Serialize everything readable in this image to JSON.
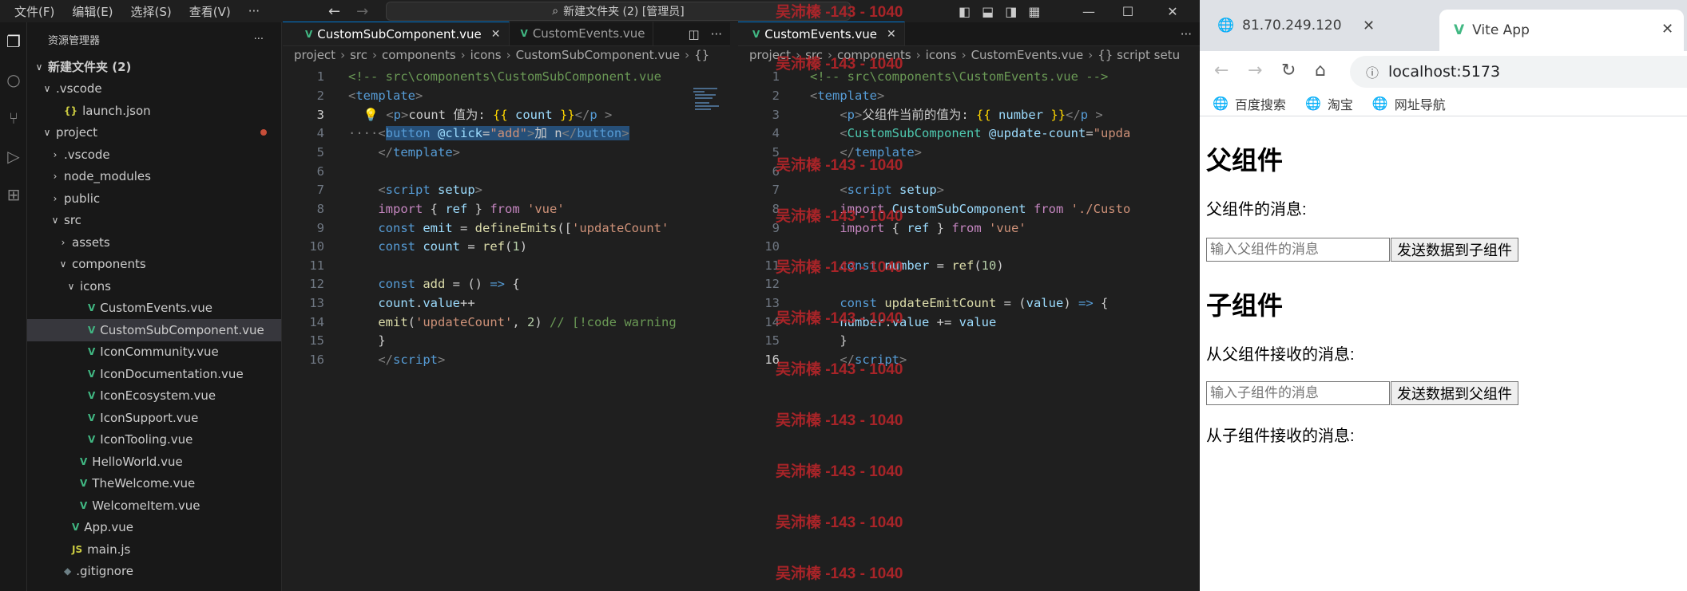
{
  "vscode": {
    "menu": [
      "文件(F)",
      "编辑(E)",
      "选择(S)",
      "查看(V)",
      "···"
    ],
    "command_center": "新建文件夹 (2) [管理员]",
    "explorer_title": "资源管理器",
    "explorer_more": "···",
    "tree": [
      {
        "label": "新建文件夹 (2)",
        "indent": 0,
        "chev": "∨",
        "icon": "",
        "bold": true
      },
      {
        "label": ".vscode",
        "indent": 1,
        "chev": "∨",
        "icon": ""
      },
      {
        "label": "launch.json",
        "indent": 2,
        "chev": "",
        "icon": "{}"
      },
      {
        "label": "project",
        "indent": 1,
        "chev": "∨",
        "icon": "",
        "modified": true
      },
      {
        "label": ".vscode",
        "indent": 2,
        "chev": "›",
        "icon": ""
      },
      {
        "label": "node_modules",
        "indent": 2,
        "chev": "›",
        "icon": ""
      },
      {
        "label": "public",
        "indent": 2,
        "chev": "›",
        "icon": ""
      },
      {
        "label": "src",
        "indent": 2,
        "chev": "∨",
        "icon": ""
      },
      {
        "label": "assets",
        "indent": 3,
        "chev": "›",
        "icon": ""
      },
      {
        "label": "components",
        "indent": 3,
        "chev": "∨",
        "icon": ""
      },
      {
        "label": "icons",
        "indent": 4,
        "chev": "∨",
        "icon": ""
      },
      {
        "label": "CustomEvents.vue",
        "indent": 5,
        "chev": "",
        "icon": "V"
      },
      {
        "label": "CustomSubComponent.vue",
        "indent": 5,
        "chev": "",
        "icon": "V",
        "selected": true
      },
      {
        "label": "IconCommunity.vue",
        "indent": 5,
        "chev": "",
        "icon": "V"
      },
      {
        "label": "IconDocumentation.vue",
        "indent": 5,
        "chev": "",
        "icon": "V"
      },
      {
        "label": "IconEcosystem.vue",
        "indent": 5,
        "chev": "",
        "icon": "V"
      },
      {
        "label": "IconSupport.vue",
        "indent": 5,
        "chev": "",
        "icon": "V"
      },
      {
        "label": "IconTooling.vue",
        "indent": 5,
        "chev": "",
        "icon": "V"
      },
      {
        "label": "HelloWorld.vue",
        "indent": 4,
        "chev": "",
        "icon": "V"
      },
      {
        "label": "TheWelcome.vue",
        "indent": 4,
        "chev": "",
        "icon": "V"
      },
      {
        "label": "WelcomeItem.vue",
        "indent": 4,
        "chev": "",
        "icon": "V"
      },
      {
        "label": "App.vue",
        "indent": 3,
        "chev": "",
        "icon": "V"
      },
      {
        "label": "main.js",
        "indent": 3,
        "chev": "",
        "icon": "JS"
      },
      {
        "label": ".gitignore",
        "indent": 2,
        "chev": "",
        "icon": "◆"
      }
    ],
    "left_group": {
      "tabs": [
        {
          "label": "CustomSubComponent.vue",
          "active": true
        },
        {
          "label": "CustomEvents.vue",
          "active": false
        }
      ],
      "breadcrumbs": [
        "project",
        "src",
        "components",
        "icons",
        "CustomSubComponent.vue",
        "{}"
      ],
      "lines": [
        {
          "n": "1",
          "tokens": [
            {
              "c": "c",
              "t": "<!-- src\\components\\CustomSubComponent.vue"
            }
          ]
        },
        {
          "n": "2",
          "tokens": [
            {
              "c": "tg",
              "t": "<"
            },
            {
              "c": "t",
              "t": "template"
            },
            {
              "c": "tg",
              "t": ">"
            }
          ]
        },
        {
          "n": "3",
          "cur": true,
          "tokens": [
            {
              "c": "txt",
              "t": "  💡 "
            },
            {
              "c": "tg",
              "t": "<"
            },
            {
              "c": "t",
              "t": "p"
            },
            {
              "c": "tg",
              "t": ">"
            },
            {
              "c": "txt",
              "t": "count 值为: "
            },
            {
              "c": "b",
              "t": "{{"
            },
            {
              "c": "v2",
              "t": " count "
            },
            {
              "c": "b",
              "t": "}}"
            },
            {
              "c": "tg",
              "t": "</"
            },
            {
              "c": "t",
              "t": "p"
            },
            {
              "c": "tg",
              "t": " >"
            }
          ]
        },
        {
          "n": "4",
          "hl": true,
          "tokens": [
            {
              "c": "tg",
              "t": "····<"
            },
            {
              "c": "t",
              "t": "button"
            },
            {
              "c": "v2",
              "t": " @click"
            },
            {
              "c": "txt",
              "t": "="
            },
            {
              "c": "s",
              "t": "\"add\""
            },
            {
              "c": "tg",
              "t": ">"
            },
            {
              "c": "txt",
              "t": "加 n"
            },
            {
              "c": "tg",
              "t": "</"
            },
            {
              "c": "t",
              "t": "button"
            },
            {
              "c": "tg",
              "t": ">"
            }
          ]
        },
        {
          "n": "5",
          "tokens": [
            {
              "c": "tg",
              "t": "    </"
            },
            {
              "c": "t",
              "t": "template"
            },
            {
              "c": "tg",
              "t": ">"
            }
          ]
        },
        {
          "n": "6",
          "tokens": []
        },
        {
          "n": "7",
          "tokens": [
            {
              "c": "tg",
              "t": "    <"
            },
            {
              "c": "t",
              "t": "script"
            },
            {
              "c": "v2",
              "t": " setup"
            },
            {
              "c": "tg",
              "t": ">"
            }
          ]
        },
        {
          "n": "8",
          "tokens": [
            {
              "c": "kw",
              "t": "    import"
            },
            {
              "c": "txt",
              "t": " { "
            },
            {
              "c": "v2",
              "t": "ref"
            },
            {
              "c": "txt",
              "t": " } "
            },
            {
              "c": "kw",
              "t": "from"
            },
            {
              "c": "s",
              "t": " 'vue'"
            }
          ]
        },
        {
          "n": "9",
          "tokens": [
            {
              "c": "k2",
              "t": "    const"
            },
            {
              "c": "v2",
              "t": " emit"
            },
            {
              "c": "txt",
              "t": " = "
            },
            {
              "c": "f",
              "t": "defineEmits"
            },
            {
              "c": "txt",
              "t": "(["
            },
            {
              "c": "s",
              "t": "'updateCount'"
            }
          ]
        },
        {
          "n": "10",
          "tokens": [
            {
              "c": "k2",
              "t": "    const"
            },
            {
              "c": "v2",
              "t": " count"
            },
            {
              "c": "txt",
              "t": " = "
            },
            {
              "c": "f",
              "t": "ref"
            },
            {
              "c": "txt",
              "t": "("
            },
            {
              "c": "n",
              "t": "1"
            },
            {
              "c": "txt",
              "t": ")"
            }
          ]
        },
        {
          "n": "11",
          "tokens": []
        },
        {
          "n": "12",
          "tokens": [
            {
              "c": "k2",
              "t": "    const"
            },
            {
              "c": "f",
              "t": " add"
            },
            {
              "c": "txt",
              "t": " = () "
            },
            {
              "c": "k2",
              "t": "=>"
            },
            {
              "c": "txt",
              "t": " {"
            }
          ]
        },
        {
          "n": "13",
          "tokens": [
            {
              "c": "v2",
              "t": "    count"
            },
            {
              "c": "txt",
              "t": "."
            },
            {
              "c": "v2",
              "t": "value"
            },
            {
              "c": "txt",
              "t": "++"
            }
          ]
        },
        {
          "n": "14",
          "tokens": [
            {
              "c": "f",
              "t": "    emit"
            },
            {
              "c": "txt",
              "t": "("
            },
            {
              "c": "s",
              "t": "'updateCount'"
            },
            {
              "c": "txt",
              "t": ", "
            },
            {
              "c": "n",
              "t": "2"
            },
            {
              "c": "txt",
              "t": ") "
            },
            {
              "c": "c",
              "t": "// [!code warning"
            }
          ]
        },
        {
          "n": "15",
          "tokens": [
            {
              "c": "txt",
              "t": "    }"
            }
          ]
        },
        {
          "n": "16",
          "tokens": [
            {
              "c": "tg",
              "t": "    </"
            },
            {
              "c": "t",
              "t": "script"
            },
            {
              "c": "tg",
              "t": ">"
            }
          ]
        }
      ]
    },
    "right_group": {
      "tabs": [
        {
          "label": "CustomEvents.vue",
          "active": true
        }
      ],
      "breadcrumbs": [
        "project",
        "src",
        "components",
        "icons",
        "CustomEvents.vue",
        "{} script setu"
      ],
      "lines": [
        {
          "n": "1",
          "tokens": [
            {
              "c": "c",
              "t": "<!-- src\\components\\CustomEvents.vue -->"
            }
          ]
        },
        {
          "n": "2",
          "tokens": [
            {
              "c": "tg",
              "t": "<"
            },
            {
              "c": "t",
              "t": "template"
            },
            {
              "c": "tg",
              "t": ">"
            }
          ]
        },
        {
          "n": "3",
          "tokens": [
            {
              "c": "tg",
              "t": "    <"
            },
            {
              "c": "t",
              "t": "p"
            },
            {
              "c": "tg",
              "t": ">"
            },
            {
              "c": "txt",
              "t": "父组件当前的值为: "
            },
            {
              "c": "b",
              "t": "{{"
            },
            {
              "c": "v2",
              "t": " number "
            },
            {
              "c": "b",
              "t": "}}"
            },
            {
              "c": "tg",
              "t": "</"
            },
            {
              "c": "t",
              "t": "p"
            },
            {
              "c": "tg",
              "t": " >"
            }
          ]
        },
        {
          "n": "4",
          "tokens": [
            {
              "c": "tg",
              "t": "    <"
            },
            {
              "c": "cls",
              "t": "CustomSubComponent"
            },
            {
              "c": "v2",
              "t": " @update-count"
            },
            {
              "c": "txt",
              "t": "="
            },
            {
              "c": "s",
              "t": "\"upda"
            }
          ]
        },
        {
          "n": "5",
          "tokens": [
            {
              "c": "tg",
              "t": "    </"
            },
            {
              "c": "t",
              "t": "template"
            },
            {
              "c": "tg",
              "t": ">"
            }
          ]
        },
        {
          "n": "6",
          "tokens": []
        },
        {
          "n": "7",
          "tokens": [
            {
              "c": "tg",
              "t": "    <"
            },
            {
              "c": "t",
              "t": "script"
            },
            {
              "c": "v2",
              "t": " setup"
            },
            {
              "c": "tg",
              "t": ">"
            }
          ]
        },
        {
          "n": "8",
          "tokens": [
            {
              "c": "kw",
              "t": "    import"
            },
            {
              "c": "v2",
              "t": " CustomSubComponent"
            },
            {
              "c": "kw",
              "t": " from"
            },
            {
              "c": "s",
              "t": " './Custo"
            }
          ]
        },
        {
          "n": "9",
          "tokens": [
            {
              "c": "kw",
              "t": "    import"
            },
            {
              "c": "txt",
              "t": " { "
            },
            {
              "c": "v2",
              "t": "ref"
            },
            {
              "c": "txt",
              "t": " } "
            },
            {
              "c": "kw",
              "t": "from"
            },
            {
              "c": "s",
              "t": " 'vue'"
            }
          ]
        },
        {
          "n": "10",
          "tokens": []
        },
        {
          "n": "11",
          "tokens": [
            {
              "c": "k2",
              "t": "    const"
            },
            {
              "c": "v2",
              "t": " number"
            },
            {
              "c": "txt",
              "t": " = "
            },
            {
              "c": "f",
              "t": "ref"
            },
            {
              "c": "txt",
              "t": "("
            },
            {
              "c": "n",
              "t": "10"
            },
            {
              "c": "txt",
              "t": ")"
            }
          ]
        },
        {
          "n": "12",
          "tokens": []
        },
        {
          "n": "13",
          "tokens": [
            {
              "c": "k2",
              "t": "    const"
            },
            {
              "c": "f",
              "t": " updateEmitCount"
            },
            {
              "c": "txt",
              "t": " = ("
            },
            {
              "c": "v2",
              "t": "value"
            },
            {
              "c": "txt",
              "t": ") "
            },
            {
              "c": "k2",
              "t": "=>"
            },
            {
              "c": "txt",
              "t": " {"
            }
          ]
        },
        {
          "n": "14",
          "tokens": [
            {
              "c": "v2",
              "t": "    number"
            },
            {
              "c": "txt",
              "t": "."
            },
            {
              "c": "v2",
              "t": "value"
            },
            {
              "c": "txt",
              "t": " += "
            },
            {
              "c": "v2",
              "t": "value"
            }
          ]
        },
        {
          "n": "15",
          "tokens": [
            {
              "c": "txt",
              "t": "    }"
            }
          ]
        },
        {
          "n": "16",
          "cur": true,
          "tokens": [
            {
              "c": "tg",
              "t": "    </"
            },
            {
              "c": "t",
              "t": "script"
            },
            {
              "c": "tg",
              "t": ">"
            }
          ]
        }
      ]
    },
    "watermark": "吴沛榛 -143 - 1040"
  },
  "browser": {
    "tabs": [
      {
        "label": "81.70.249.120",
        "active": false
      },
      {
        "label": "Vite App",
        "active": true
      }
    ],
    "url": "localhost:5173",
    "bookmarks": [
      "百度搜索",
      "淘宝",
      "网址导航"
    ],
    "page": {
      "parent_heading": "父组件",
      "parent_message_label": "父组件的消息:",
      "parent_input_placeholder": "输入父组件的消息",
      "parent_button": "发送数据到子组件",
      "child_heading": "子组件",
      "child_received_label": "从父组件接收的消息:",
      "child_input_placeholder": "输入子组件的消息",
      "child_button": "发送数据到父组件",
      "child_sent_label": "从子组件接收的消息:"
    }
  }
}
